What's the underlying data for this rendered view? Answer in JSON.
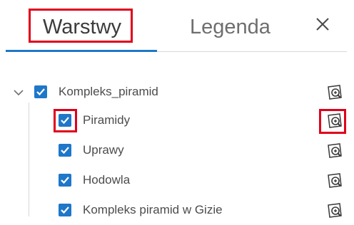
{
  "tabs": {
    "layers_label": "Warstwy",
    "legend_label": "Legenda",
    "active": "Warstwy"
  },
  "close_icon": "close-icon",
  "colors": {
    "accent": "#1e77c8",
    "highlight": "#e0001b",
    "text": "#4c4c4c"
  },
  "tree": {
    "group": {
      "label": "Kompleks_piramid",
      "checked": true,
      "expanded": true
    },
    "items": [
      {
        "label": "Piramidy",
        "checked": true
      },
      {
        "label": "Uprawy",
        "checked": true
      },
      {
        "label": "Hodowla",
        "checked": true
      },
      {
        "label": "Kompleks piramid w Gizie",
        "checked": true
      }
    ],
    "zoom_icon": "zoom-to-layer-icon"
  }
}
